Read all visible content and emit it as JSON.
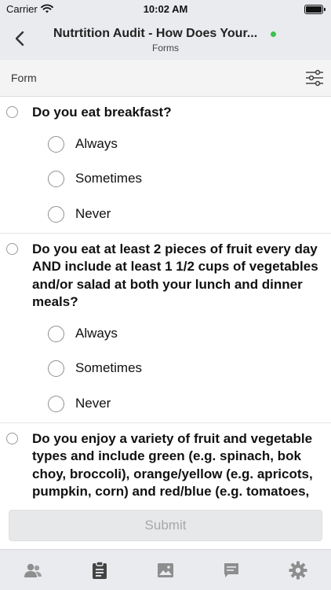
{
  "status_bar": {
    "carrier": "Carrier",
    "time": "10:02 AM"
  },
  "nav": {
    "title": "Nutrtition Audit - How Does Your...",
    "subtitle": "Forms"
  },
  "section": {
    "label": "Form"
  },
  "questions": [
    {
      "text": "Do you eat breakfast?",
      "options": [
        "Always",
        "Sometimes",
        "Never"
      ]
    },
    {
      "text": "Do you eat at least 2 pieces of fruit every day AND include at least 1 1/2 cups of vegetables and/or salad at both your lunch and dinner meals?",
      "options": [
        "Always",
        "Sometimes",
        "Never"
      ]
    },
    {
      "text": "Do you enjoy a variety of fruit and vegetable types and include green (e.g. spinach, bok choy, broccoli), orange/yellow (e.g. apricots, pumpkin, corn) and red/blue (e.g. tomatoes, blueberries, beets) colours",
      "options": []
    }
  ],
  "submit": {
    "label": "Submit"
  },
  "tabs": [
    {
      "icon": "people-icon",
      "active": false
    },
    {
      "icon": "clipboard-icon",
      "active": true
    },
    {
      "icon": "image-icon",
      "active": false
    },
    {
      "icon": "chat-icon",
      "active": false
    },
    {
      "icon": "gear-icon",
      "active": false
    }
  ],
  "colors": {
    "status_dot": "#3cc24f",
    "tab_active": "#444444",
    "tab_inactive": "#8e8e8e",
    "header_bg": "#e9ebee"
  }
}
